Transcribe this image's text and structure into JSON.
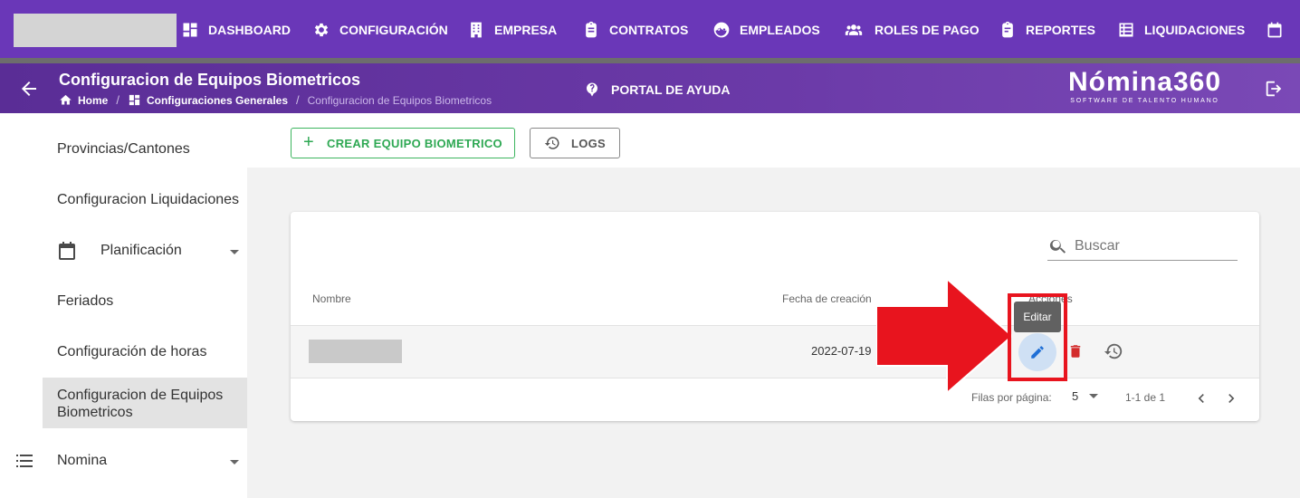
{
  "topnav": {
    "items": [
      {
        "label": "DASHBOARD",
        "icon": "dashboard-icon"
      },
      {
        "label": "CONFIGURACIÓN",
        "icon": "gear-icon"
      },
      {
        "label": "EMPRESA",
        "icon": "building-icon"
      },
      {
        "label": "CONTRATOS",
        "icon": "clipboard-icon"
      },
      {
        "label": "EMPLEADOS",
        "icon": "face-icon"
      },
      {
        "label": "ROLES DE PAGO",
        "icon": "group-icon"
      },
      {
        "label": "REPORTES",
        "icon": "report-icon"
      },
      {
        "label": "LIQUIDACIONES",
        "icon": "list-icon"
      },
      {
        "label": "",
        "icon": "calendar-icon"
      }
    ]
  },
  "header": {
    "title": "Configuracion de Equipos Biometricos",
    "breadcrumb": [
      "Home",
      "Configuraciones Generales",
      "Configuracion de Equipos Biometricos"
    ],
    "help_label": "PORTAL DE AYUDA",
    "brand_name": "Nómina360",
    "brand_tagline": "SOFTWARE DE TALENTO HUMANO"
  },
  "sidebar": {
    "items": [
      {
        "label": "Provincias/Cantones"
      },
      {
        "label": "Configuracion Liquidaciones"
      },
      {
        "label": "Planificación",
        "icon": "calendar-icon",
        "expandable": true
      },
      {
        "label": "Feriados"
      },
      {
        "label": "Configuración de horas"
      },
      {
        "label": "Configuracion de Equipos Biometricos",
        "active": true
      },
      {
        "label": "Nomina",
        "icon": "list-icon",
        "expandable": true
      }
    ]
  },
  "toolbar": {
    "create_label": "CREAR EQUIPO BIOMETRICO",
    "logs_label": "LOGS"
  },
  "table": {
    "search_placeholder": "Buscar",
    "columns": [
      "Nombre",
      "Fecha de creación",
      "Acciones"
    ],
    "rows": [
      {
        "nombre": "",
        "fecha": "2022-07-19"
      }
    ],
    "rows_per_page_label": "Filas por página:",
    "rows_per_page_value": "5",
    "range_label": "1-1 de 1"
  },
  "tooltip": {
    "label": "Editar"
  },
  "colors": {
    "primary": "#6a37b8",
    "create_green": "#2ea853",
    "edit_blue": "#1f6fd6",
    "delete_red": "#d32b2b",
    "annotation_red": "#e8141e"
  }
}
